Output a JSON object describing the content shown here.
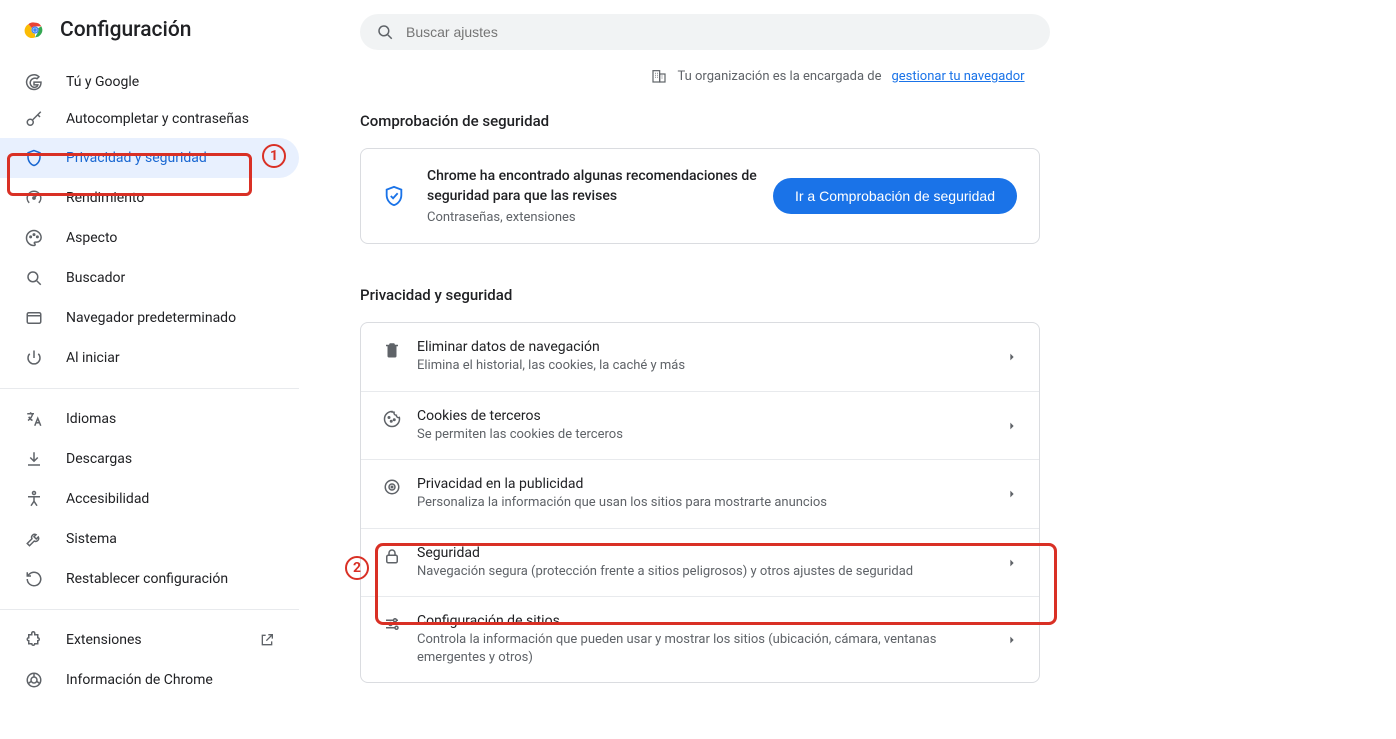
{
  "header": {
    "title": "Configuración"
  },
  "search": {
    "placeholder": "Buscar ajustes"
  },
  "banner": {
    "text": "Tu organización es la encargada de",
    "link": "gestionar tu navegador"
  },
  "sidebar": {
    "items": [
      {
        "label": "Tú y Google"
      },
      {
        "label": "Autocompletar y contraseñas"
      },
      {
        "label": "Privacidad y seguridad"
      },
      {
        "label": "Rendimiento"
      },
      {
        "label": "Aspecto"
      },
      {
        "label": "Buscador"
      },
      {
        "label": "Navegador predeterminado"
      },
      {
        "label": "Al iniciar"
      },
      {
        "label": "Idiomas"
      },
      {
        "label": "Descargas"
      },
      {
        "label": "Accesibilidad"
      },
      {
        "label": "Sistema"
      },
      {
        "label": "Restablecer configuración"
      },
      {
        "label": "Extensiones"
      },
      {
        "label": "Información de Chrome"
      }
    ]
  },
  "safety": {
    "heading": "Comprobación de seguridad",
    "title": "Chrome ha encontrado algunas recomendaciones de seguridad para que las revises",
    "subtitle": "Contraseñas, extensiones",
    "button": "Ir a Comprobación de seguridad"
  },
  "privacy": {
    "heading": "Privacidad y seguridad",
    "rows": [
      {
        "title": "Eliminar datos de navegación",
        "desc": "Elimina el historial, las cookies, la caché y más"
      },
      {
        "title": "Cookies de terceros",
        "desc": "Se permiten las cookies de terceros"
      },
      {
        "title": "Privacidad en la publicidad",
        "desc": "Personaliza la información que usan los sitios para mostrarte anuncios"
      },
      {
        "title": "Seguridad",
        "desc": "Navegación segura (protección frente a sitios peligrosos) y otros ajustes de seguridad"
      },
      {
        "title": "Configuración de sitios",
        "desc": "Controla la información que pueden usar y mostrar los sitios (ubicación, cámara, ventanas emergentes y otros)"
      }
    ]
  },
  "annotations": {
    "one": "1",
    "two": "2"
  }
}
